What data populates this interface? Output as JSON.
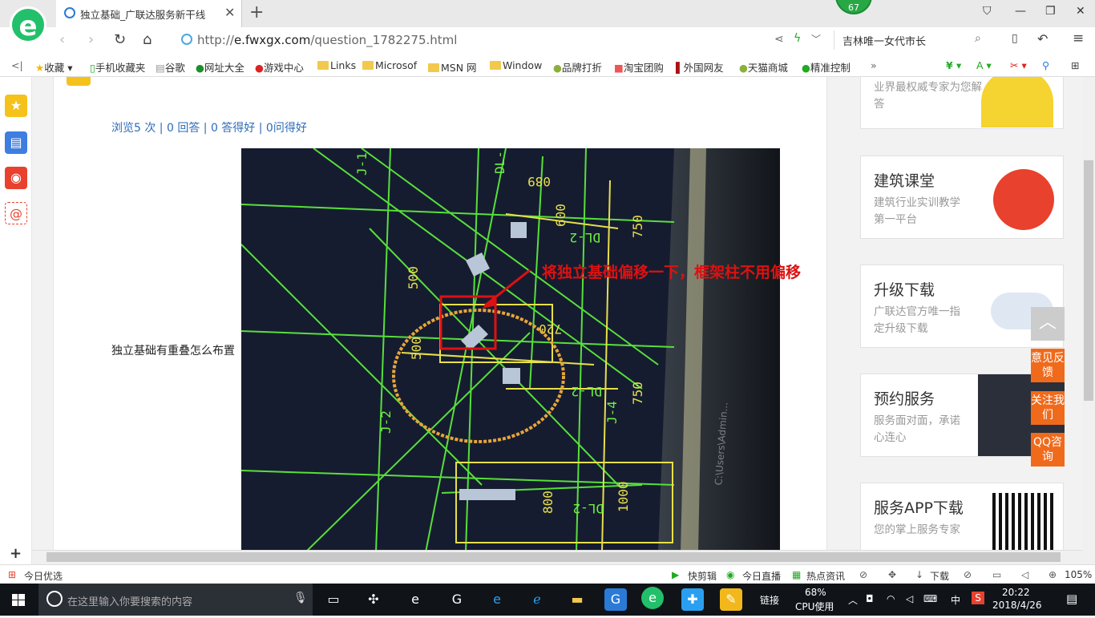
{
  "browser": {
    "tab_title": "独立基础_广联达服务新干线",
    "badge_count": "67",
    "url_prefix": "http://",
    "url_domain": "e.fwxgx.com",
    "url_path": "/question_1782275.html",
    "search_text": "吉林唯一女代市长",
    "zoom": "105%"
  },
  "favorites": [
    "收藏",
    "手机收藏夹",
    "谷歌",
    "网址大全",
    "游戏中心",
    "Links",
    "Microsof",
    "MSN 网",
    "Window",
    "品牌打折",
    "淘宝团购",
    "外国网友",
    "天猫商城",
    "精准控制"
  ],
  "question": {
    "stats": "浏览5 次 | 0 回答 | 0 答得好 | 0问得好",
    "text": "独立基础有重叠怎么布置",
    "annotation": "将独立基础偏移一下，框架柱不用偏移"
  },
  "ads": [
    {
      "title": "",
      "desc": "业界最权威专家为您解答"
    },
    {
      "title": "建筑课堂",
      "desc": "建筑行业实训教学第一平台"
    },
    {
      "title": "升级下载",
      "desc": "广联达官方唯一指定升级下载"
    },
    {
      "title": "预约服务",
      "desc": "服务面对面，承诺心连心"
    },
    {
      "title": "服务APP下载",
      "desc": "您的掌上服务专家"
    }
  ],
  "float_buttons": [
    "意见反馈",
    "关注我们",
    "QQ咨询"
  ],
  "status_bar": {
    "left": "今日优选",
    "items": [
      "快剪辑",
      "今日直播",
      "热点资讯",
      "下载"
    ]
  },
  "taskbar": {
    "search_placeholder": "在这里输入你要搜索的内容",
    "link_label": "链接",
    "cpu_percent": "68%",
    "cpu_label": "CPU使用",
    "ime": "中",
    "time": "20:22",
    "date": "2018/4/26"
  },
  "colors": {
    "accent_green": "#22c06a",
    "link_blue": "#2e6bb7",
    "float_orange": "#f06a1b",
    "annotation_red": "#dd1111"
  }
}
